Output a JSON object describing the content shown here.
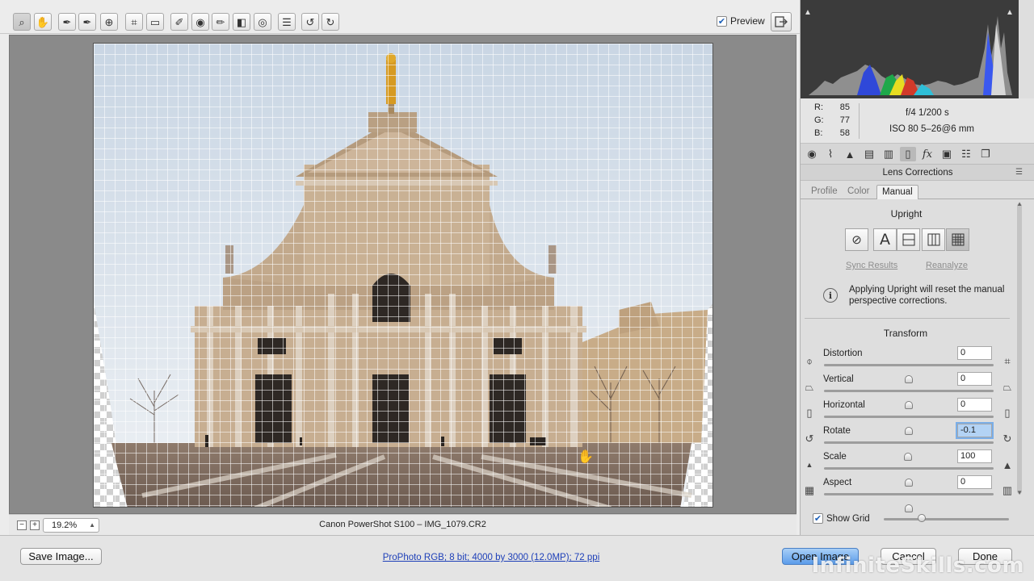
{
  "toolbar": {
    "tools": [
      {
        "name": "zoom-tool",
        "icon": "zoom-icon",
        "glyph": "🔍"
      },
      {
        "name": "hand-tool",
        "icon": "hand-icon",
        "glyph": "✋"
      },
      {
        "name": "white-balance-tool",
        "icon": "eyedropper-icon",
        "glyph": "✎"
      },
      {
        "name": "color-sampler-tool",
        "icon": "color-sampler-icon",
        "glyph": "✎"
      },
      {
        "name": "targeted-adjustment-tool",
        "icon": "target-adjust-icon",
        "glyph": "⊕"
      },
      {
        "name": "crop-tool",
        "icon": "crop-icon",
        "glyph": "⌗"
      },
      {
        "name": "straighten-tool",
        "icon": "straighten-icon",
        "glyph": "▭"
      },
      {
        "name": "spot-removal-tool",
        "icon": "spot-removal-icon",
        "glyph": "✐"
      },
      {
        "name": "red-eye-tool",
        "icon": "red-eye-icon",
        "glyph": "◉"
      },
      {
        "name": "adjustment-brush-tool",
        "icon": "brush-icon",
        "glyph": "✏"
      },
      {
        "name": "graduated-filter-tool",
        "icon": "graduated-filter-icon",
        "glyph": "◧"
      },
      {
        "name": "radial-filter-tool",
        "icon": "radial-filter-icon",
        "glyph": "◎"
      },
      {
        "name": "preferences-tool",
        "icon": "list-icon",
        "glyph": "☰"
      },
      {
        "name": "rotate-left-tool",
        "icon": "rotate-ccw-icon",
        "glyph": "↺"
      },
      {
        "name": "rotate-right-tool",
        "icon": "rotate-cw-icon",
        "glyph": "↻"
      }
    ],
    "preview_label": "Preview",
    "preview_checked": true
  },
  "status": {
    "zoom": "19.2%",
    "filename": "Canon PowerShot S100  –  IMG_1079.CR2"
  },
  "readout": {
    "r_label": "R:",
    "r": "85",
    "g_label": "G:",
    "g": "77",
    "b_label": "B:",
    "b": "58",
    "exif_line1": "f/4    1/200 s",
    "exif_line2": "ISO 80    5–26@6 mm"
  },
  "panel": {
    "icons": [
      "basic-icon",
      "tone-curve-icon",
      "detail-icon",
      "hsl-icon",
      "split-toning-icon",
      "lens-corrections-icon",
      "effects-icon",
      "camera-calibration-icon",
      "presets-icon",
      "snapshots-icon"
    ],
    "title": "Lens Corrections",
    "tabs": [
      "Profile",
      "Color",
      "Manual"
    ],
    "active_tab": "Manual",
    "upright_title": "Upright",
    "upright_buttons": [
      "off",
      "auto",
      "level",
      "vertical",
      "full"
    ],
    "sync_results": "Sync Results",
    "reanalyze": "Reanalyze",
    "info_text": "Applying Upright will reset the manual perspective corrections.",
    "transform_title": "Transform",
    "sliders": [
      {
        "label": "Distortion",
        "value": "0",
        "min": -100,
        "max": 100,
        "num": 0
      },
      {
        "label": "Vertical",
        "value": "0",
        "min": -100,
        "max": 100,
        "num": 0
      },
      {
        "label": "Horizontal",
        "value": "0",
        "min": -100,
        "max": 100,
        "num": 0
      },
      {
        "label": "Rotate",
        "value": "-0.1",
        "min": -10,
        "max": 10,
        "num": -0.1
      },
      {
        "label": "Scale",
        "value": "100",
        "min": 50,
        "max": 150,
        "num": 100
      },
      {
        "label": "Aspect",
        "value": "0",
        "min": -100,
        "max": 100,
        "num": 0
      }
    ],
    "show_grid_label": "Show Grid",
    "show_grid_checked": true,
    "grid_size_level": 0.3
  },
  "bottom": {
    "save_image": "Save Image...",
    "workflow_options": "ProPhoto RGB; 8 bit; 4000 by 3000 (12.0MP); 72 ppi",
    "open_image": "Open Image",
    "cancel": "Cancel",
    "done": "Done"
  },
  "watermark": "InfiniteSkills.com",
  "colors": {
    "accent": "#5b9cea",
    "link": "#1d3fb8",
    "sky": "#dbe3ec",
    "facade": "#c3ab8e"
  }
}
